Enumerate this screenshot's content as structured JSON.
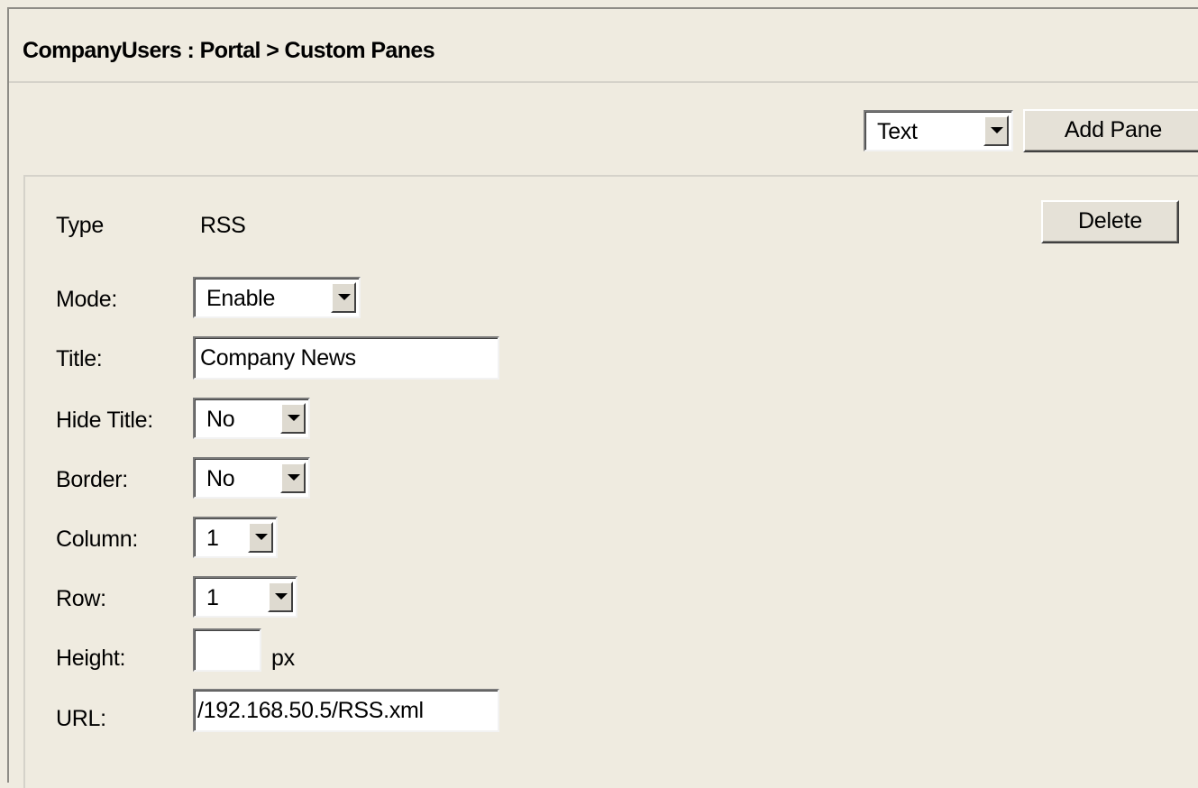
{
  "breadcrumb": "CompanyUsers : Portal > Custom Panes",
  "toolbar": {
    "pane_type_selected": "Text",
    "add_pane_label": "Add Pane"
  },
  "pane": {
    "type_label": "Type",
    "type_value": "RSS",
    "delete_label": "Delete",
    "mode": {
      "label": "Mode:",
      "value": "Enable"
    },
    "title": {
      "label": "Title:",
      "value": "Company News"
    },
    "hide_title": {
      "label": "Hide Title:",
      "value": "No"
    },
    "border": {
      "label": "Border:",
      "value": "No"
    },
    "column": {
      "label": "Column:",
      "value": "1"
    },
    "row": {
      "label": "Row:",
      "value": "1"
    },
    "height": {
      "label": "Height:",
      "value": "",
      "unit": "px"
    },
    "url": {
      "label": "URL:",
      "value": "/192.168.50.5/RSS.xml"
    }
  },
  "icons": {
    "dropdown_arrow": "chevron-down-icon"
  }
}
